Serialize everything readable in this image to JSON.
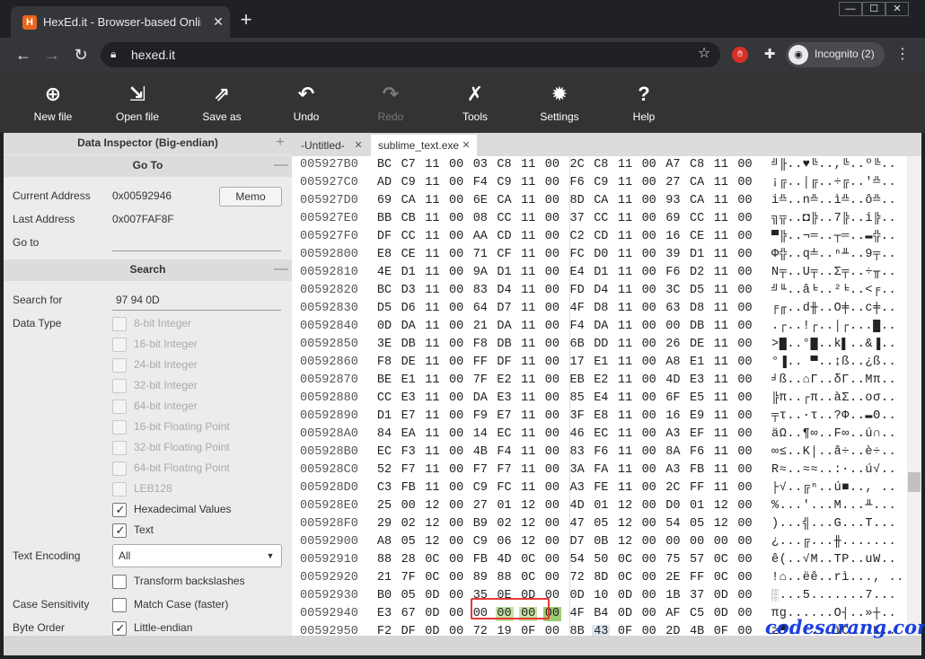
{
  "browser": {
    "tab_title": "HexEd.it - Browser-based Online",
    "tab_favicon": "H",
    "url": "hexed.it",
    "incognito_label": "Incognito (2)"
  },
  "toolbar": {
    "buttons": [
      {
        "label": "New file",
        "icon": "new-file-icon",
        "enabled": true
      },
      {
        "label": "Open file",
        "icon": "open-file-icon",
        "enabled": true
      },
      {
        "label": "Save as",
        "icon": "save-as-icon",
        "enabled": true
      },
      {
        "label": "Undo",
        "icon": "undo-icon",
        "enabled": true
      },
      {
        "label": "Redo",
        "icon": "redo-icon",
        "enabled": false
      },
      {
        "label": "Tools",
        "icon": "tools-icon",
        "enabled": true
      },
      {
        "label": "Settings",
        "icon": "gear-icon",
        "enabled": true
      },
      {
        "label": "Help",
        "icon": "help-icon",
        "enabled": true
      }
    ]
  },
  "inspector": {
    "title": "Data Inspector (Big-endian)",
    "goto_title": "Go To",
    "current_address_label": "Current Address",
    "current_address": "0x00592946",
    "memo_label": "Memo",
    "last_address_label": "Last Address",
    "last_address": "0x007FAF8F",
    "goto_label": "Go to",
    "search_title": "Search",
    "search_for_label": "Search for",
    "search_for_value": "97 94 0D",
    "data_type_label": "Data Type",
    "data_types": [
      {
        "label": "8-bit Integer",
        "checked": false,
        "enabled": false
      },
      {
        "label": "16-bit Integer",
        "checked": false,
        "enabled": false
      },
      {
        "label": "24-bit Integer",
        "checked": false,
        "enabled": false
      },
      {
        "label": "32-bit Integer",
        "checked": false,
        "enabled": false
      },
      {
        "label": "64-bit Integer",
        "checked": false,
        "enabled": false
      },
      {
        "label": "16-bit Floating Point",
        "checked": false,
        "enabled": false
      },
      {
        "label": "32-bit Floating Point",
        "checked": false,
        "enabled": false
      },
      {
        "label": "64-bit Floating Point",
        "checked": false,
        "enabled": false
      },
      {
        "label": "LEB128",
        "checked": false,
        "enabled": false
      },
      {
        "label": "Hexadecimal Values",
        "checked": true,
        "enabled": true
      },
      {
        "label": "Text",
        "checked": true,
        "enabled": true
      }
    ],
    "text_encoding_label": "Text Encoding",
    "text_encoding_value": "All",
    "transform_backslashes_label": "Transform backslashes",
    "case_sensitivity_label": "Case Sensitivity",
    "match_case_label": "Match Case (faster)",
    "byte_order_label": "Byte Order",
    "little_endian_label": "Little-endian"
  },
  "files": {
    "tabs": [
      {
        "label": "-Untitled-",
        "active": false
      },
      {
        "label": "sublime_text.exe",
        "active": true
      }
    ]
  },
  "hex": {
    "rows": [
      {
        "addr": "005927B0",
        "bytes": [
          "BC",
          "C7",
          "11",
          "00",
          "03",
          "C8",
          "11",
          "00",
          "2C",
          "C8",
          "11",
          "00",
          "A7",
          "C8",
          "11",
          "00"
        ],
        "text": "╝╟..♥╚..,╚..º╚.."
      },
      {
        "addr": "005927C0",
        "bytes": [
          "AD",
          "C9",
          "11",
          "00",
          "F4",
          "C9",
          "11",
          "00",
          "F6",
          "C9",
          "11",
          "00",
          "27",
          "CA",
          "11",
          "00"
        ],
        "text": "¡╔..⌠╔..÷╔..'╩.."
      },
      {
        "addr": "005927D0",
        "bytes": [
          "69",
          "CA",
          "11",
          "00",
          "6E",
          "CA",
          "11",
          "00",
          "8D",
          "CA",
          "11",
          "00",
          "93",
          "CA",
          "11",
          "00"
        ],
        "text": "i╩..n╩..ì╩..ô╩.."
      },
      {
        "addr": "005927E0",
        "bytes": [
          "BB",
          "CB",
          "11",
          "00",
          "08",
          "CC",
          "11",
          "00",
          "37",
          "CC",
          "11",
          "00",
          "69",
          "CC",
          "11",
          "00"
        ],
        "text": "╗╦..◘╠..7╠..i╠.."
      },
      {
        "addr": "005927F0",
        "bytes": [
          "DF",
          "CC",
          "11",
          "00",
          "AA",
          "CD",
          "11",
          "00",
          "C2",
          "CD",
          "11",
          "00",
          "16",
          "CE",
          "11",
          "00"
        ],
        "text": "▀╠..¬═..┬═..▬╬.."
      },
      {
        "addr": "00592800",
        "bytes": [
          "E8",
          "CE",
          "11",
          "00",
          "71",
          "CF",
          "11",
          "00",
          "FC",
          "D0",
          "11",
          "00",
          "39",
          "D1",
          "11",
          "00"
        ],
        "text": "Φ╬..q╧..ⁿ╨..9╤.."
      },
      {
        "addr": "00592810",
        "bytes": [
          "4E",
          "D1",
          "11",
          "00",
          "9A",
          "D1",
          "11",
          "00",
          "E4",
          "D1",
          "11",
          "00",
          "F6",
          "D2",
          "11",
          "00"
        ],
        "text": "N╤..Ü╤..Σ╤..÷╥.."
      },
      {
        "addr": "00592820",
        "bytes": [
          "BC",
          "D3",
          "11",
          "00",
          "83",
          "D4",
          "11",
          "00",
          "FD",
          "D4",
          "11",
          "00",
          "3C",
          "D5",
          "11",
          "00"
        ],
        "text": "╝╙..â╘..²╘..<╒.."
      },
      {
        "addr": "00592830",
        "bytes": [
          "D5",
          "D6",
          "11",
          "00",
          "64",
          "D7",
          "11",
          "00",
          "4F",
          "D8",
          "11",
          "00",
          "63",
          "D8",
          "11",
          "00"
        ],
        "text": "╒╓..d╫..O╪..c╪.."
      },
      {
        "addr": "00592840",
        "bytes": [
          "0D",
          "DA",
          "11",
          "00",
          "21",
          "DA",
          "11",
          "00",
          "F4",
          "DA",
          "11",
          "00",
          "00",
          "DB",
          "11",
          "00"
        ],
        "text": ".┌..!┌..⌠┌...█.."
      },
      {
        "addr": "00592850",
        "bytes": [
          "3E",
          "DB",
          "11",
          "00",
          "F8",
          "DB",
          "11",
          "00",
          "6B",
          "DD",
          "11",
          "00",
          "26",
          "DE",
          "11",
          "00"
        ],
        "text": ">█..°█..k▌..&▐.."
      },
      {
        "addr": "00592860",
        "bytes": [
          "F8",
          "DE",
          "11",
          "00",
          "FF",
          "DF",
          "11",
          "00",
          "17",
          "E1",
          "11",
          "00",
          "A8",
          "E1",
          "11",
          "00"
        ],
        "text": "°▐.. ▀..↨ß..¿ß.."
      },
      {
        "addr": "00592870",
        "bytes": [
          "BE",
          "E1",
          "11",
          "00",
          "7F",
          "E2",
          "11",
          "00",
          "EB",
          "E2",
          "11",
          "00",
          "4D",
          "E3",
          "11",
          "00"
        ],
        "text": "╛ß..⌂Γ..δΓ..Mπ.."
      },
      {
        "addr": "00592880",
        "bytes": [
          "CC",
          "E3",
          "11",
          "00",
          "DA",
          "E3",
          "11",
          "00",
          "85",
          "E4",
          "11",
          "00",
          "6F",
          "E5",
          "11",
          "00"
        ],
        "text": "╠π..┌π..àΣ..oσ.."
      },
      {
        "addr": "00592890",
        "bytes": [
          "D1",
          "E7",
          "11",
          "00",
          "F9",
          "E7",
          "11",
          "00",
          "3F",
          "E8",
          "11",
          "00",
          "16",
          "E9",
          "11",
          "00"
        ],
        "text": "╤τ..·τ..?Φ..▬Θ.."
      },
      {
        "addr": "005928A0",
        "bytes": [
          "84",
          "EA",
          "11",
          "00",
          "14",
          "EC",
          "11",
          "00",
          "46",
          "EC",
          "11",
          "00",
          "A3",
          "EF",
          "11",
          "00"
        ],
        "text": "äΩ..¶∞..F∞..ú∩.."
      },
      {
        "addr": "005928B0",
        "bytes": [
          "EC",
          "F3",
          "11",
          "00",
          "4B",
          "F4",
          "11",
          "00",
          "83",
          "F6",
          "11",
          "00",
          "8A",
          "F6",
          "11",
          "00"
        ],
        "text": "∞≤..K⌠..â÷..è÷.."
      },
      {
        "addr": "005928C0",
        "bytes": [
          "52",
          "F7",
          "11",
          "00",
          "F7",
          "F7",
          "11",
          "00",
          "3A",
          "FA",
          "11",
          "00",
          "A3",
          "FB",
          "11",
          "00"
        ],
        "text": "R≈..≈≈..:·..ú√.."
      },
      {
        "addr": "005928D0",
        "bytes": [
          "C3",
          "FB",
          "11",
          "00",
          "C9",
          "FC",
          "11",
          "00",
          "A3",
          "FE",
          "11",
          "00",
          "2C",
          "FF",
          "11",
          "00"
        ],
        "text": "├√..╔ⁿ..ú■.., .."
      },
      {
        "addr": "005928E0",
        "bytes": [
          "25",
          "00",
          "12",
          "00",
          "27",
          "01",
          "12",
          "00",
          "4D",
          "01",
          "12",
          "00",
          "D0",
          "01",
          "12",
          "00"
        ],
        "text": "%...'...M...╨..."
      },
      {
        "addr": "005928F0",
        "bytes": [
          "29",
          "02",
          "12",
          "00",
          "B9",
          "02",
          "12",
          "00",
          "47",
          "05",
          "12",
          "00",
          "54",
          "05",
          "12",
          "00"
        ],
        "text": ")...╣...G...T..."
      },
      {
        "addr": "00592900",
        "bytes": [
          "A8",
          "05",
          "12",
          "00",
          "C9",
          "06",
          "12",
          "00",
          "D7",
          "0B",
          "12",
          "00",
          "00",
          "00",
          "00",
          "00"
        ],
        "text": "¿...╔...╫......."
      },
      {
        "addr": "00592910",
        "bytes": [
          "88",
          "28",
          "0C",
          "00",
          "FB",
          "4D",
          "0C",
          "00",
          "54",
          "50",
          "0C",
          "00",
          "75",
          "57",
          "0C",
          "00"
        ],
        "text": "ê(..√M..TP..uW.."
      },
      {
        "addr": "00592920",
        "bytes": [
          "21",
          "7F",
          "0C",
          "00",
          "89",
          "88",
          "0C",
          "00",
          "72",
          "8D",
          "0C",
          "00",
          "2E",
          "FF",
          "0C",
          "00"
        ],
        "text": "!⌂..ëê..rì..., .."
      },
      {
        "addr": "00592930",
        "bytes": [
          "B0",
          "05",
          "0D",
          "00",
          "35",
          "0E",
          "0D",
          "00",
          "0D",
          "10",
          "0D",
          "00",
          "1B",
          "37",
          "0D",
          "00"
        ],
        "text": "░...5.......7..."
      },
      {
        "addr": "00592940",
        "bytes": [
          "E3",
          "67",
          "0D",
          "00",
          "00",
          "00",
          "00",
          "00",
          "4F",
          "B4",
          "0D",
          "00",
          "AF",
          "C5",
          "0D",
          "00"
        ],
        "text": "πg......O┤..»┼.."
      },
      {
        "addr": "00592950",
        "bytes": [
          "F2",
          "DF",
          "0D",
          "00",
          "72",
          "19",
          "0F",
          "00",
          "8B",
          "43",
          "0F",
          "00",
          "2D",
          "4B",
          "0F",
          "00"
        ],
        "text": "≥▀..r...ïC..-K.."
      }
    ]
  },
  "watermark": "codesarang.com"
}
